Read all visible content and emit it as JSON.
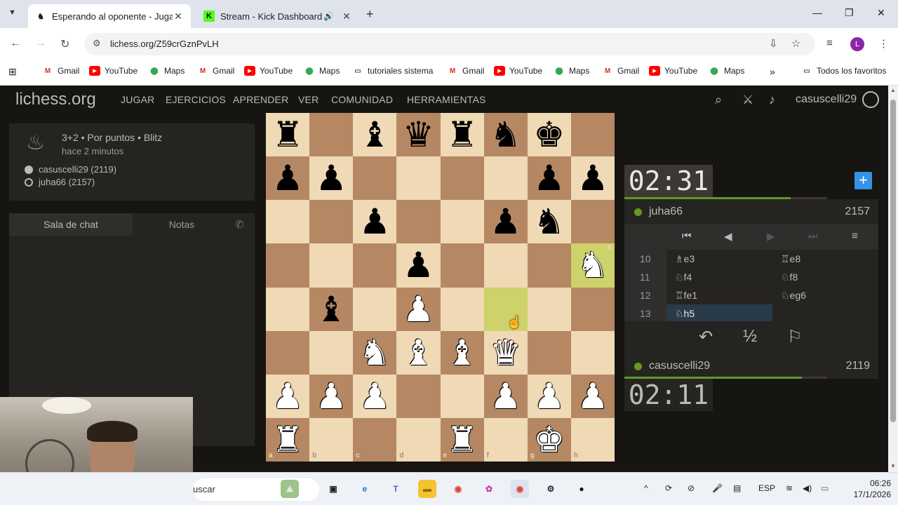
{
  "browser": {
    "tabs": [
      {
        "title": "Esperando al oponente - Jugar",
        "favicon": "lichess-icon"
      },
      {
        "title": "Stream - Kick Dashboard",
        "favicon": "kick-icon"
      }
    ],
    "url": "lichess.org/Z59crGznPvLH",
    "profile_initial": "L",
    "bookmarks": [
      {
        "label": "Gmail",
        "icon": "gmail-icon"
      },
      {
        "label": "YouTube",
        "icon": "youtube-icon"
      },
      {
        "label": "Maps",
        "icon": "maps-icon"
      },
      {
        "label": "Gmail",
        "icon": "gmail-icon"
      },
      {
        "label": "YouTube",
        "icon": "youtube-icon"
      },
      {
        "label": "Maps",
        "icon": "maps-icon"
      },
      {
        "label": "tutoriales sistema",
        "icon": "folder-icon"
      },
      {
        "label": "Gmail",
        "icon": "gmail-icon"
      },
      {
        "label": "YouTube",
        "icon": "youtube-icon"
      },
      {
        "label": "Maps",
        "icon": "maps-icon"
      },
      {
        "label": "Gmail",
        "icon": "gmail-icon"
      },
      {
        "label": "YouTube",
        "icon": "youtube-icon"
      },
      {
        "label": "Maps",
        "icon": "maps-icon"
      }
    ],
    "all_bookmarks": "Todos los favoritos"
  },
  "lichess": {
    "logo": "lichess.org",
    "nav": [
      "JUGAR",
      "EJERCICIOS",
      "APRENDER",
      "VER",
      "COMUNIDAD",
      "HERRAMIENTAS"
    ],
    "username": "casuscelli29",
    "game": {
      "mode": "3+2 • Por puntos • Blitz",
      "when": "hace 2 minutos",
      "white_player": "casuscelli29 (2119)",
      "black_player": "juha66 (2157)"
    },
    "chat_tabs": [
      "Sala de chat",
      "Notas"
    ],
    "opponent": {
      "name": "juha66",
      "rating": "2157",
      "clock": "02:31",
      "time_fraction": 0.82
    },
    "me": {
      "name": "casuscelli29",
      "rating": "2119",
      "clock": "02:11",
      "time_fraction": 0.7
    },
    "moves": [
      {
        "num": "10",
        "white": "♗e3",
        "black": "♖e8"
      },
      {
        "num": "11",
        "white": "♘f4",
        "black": "♘f8"
      },
      {
        "num": "12",
        "white": "♖fe1",
        "black": "♘eg6"
      },
      {
        "num": "13",
        "white": "♘h5",
        "black": ""
      }
    ],
    "controls": {
      "takeback": "↶",
      "draw": "½",
      "resign": "⚐"
    },
    "board": {
      "files": [
        "a",
        "b",
        "c",
        "d",
        "e",
        "f",
        "g",
        "h"
      ],
      "ranks": [
        "8",
        "7",
        "6",
        "5",
        "4",
        "3",
        "2",
        "1"
      ],
      "position": [
        [
          "r",
          "",
          "b",
          "q",
          "r",
          "n",
          "k",
          ""
        ],
        [
          "p",
          "p",
          "",
          "",
          "",
          "",
          "p",
          "p"
        ],
        [
          "",
          "",
          "p",
          "",
          "",
          "p",
          "n",
          ""
        ],
        [
          "",
          "",
          "",
          "p",
          "",
          "",
          "",
          "N"
        ],
        [
          "",
          "b",
          "",
          "P",
          "",
          "",
          "",
          ""
        ],
        [
          "",
          "",
          "N",
          "B",
          "B",
          "Q",
          "",
          ""
        ],
        [
          "P",
          "P",
          "P",
          "",
          "",
          "P",
          "P",
          "P"
        ],
        [
          "R",
          "",
          "",
          "",
          "R",
          "",
          "K",
          ""
        ]
      ],
      "last_move": [
        "f4",
        "h5"
      ],
      "light_color": "#f0d9b5",
      "dark_color": "#b58863",
      "highlight_color": "#cdd26a"
    }
  },
  "taskbar": {
    "search_text": "uscar",
    "language": "ESP",
    "time": "06:26",
    "date": "17/1/2026"
  }
}
